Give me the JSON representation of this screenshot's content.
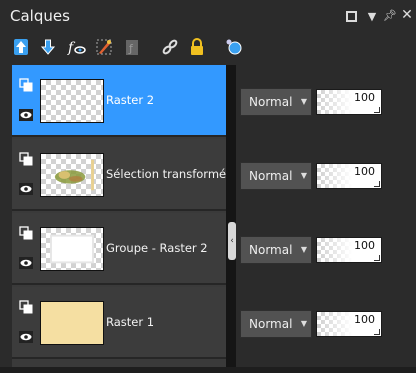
{
  "window": {
    "title": "Calques",
    "controls": [
      "restore-icon",
      "menu-arrow-icon",
      "pin-icon",
      "close-icon"
    ]
  },
  "toolbar": {
    "tools": [
      "new-raster-layer-icon",
      "new-vector-layer-icon",
      "effects-icon",
      "brush-icon",
      "mask-icon",
      "link-icon",
      "lock-icon",
      "layer-style-icon"
    ]
  },
  "layers": [
    {
      "name": "Raster 2",
      "blend": "Normal",
      "opacity": "100",
      "selected": true,
      "thumb": "transparent"
    },
    {
      "name": "Sélection transformée",
      "blend": "Normal",
      "opacity": "100",
      "selected": false,
      "thumb": "image"
    },
    {
      "name": "Groupe - Raster 2",
      "blend": "Normal",
      "opacity": "100",
      "selected": false,
      "thumb": "frame"
    },
    {
      "name": "Raster 1",
      "blend": "Normal",
      "opacity": "100",
      "selected": false,
      "thumb": "solid"
    }
  ],
  "colors": {
    "selection": "#3399ff",
    "panel_bg": "#2b2b2b",
    "raster1_fill": "#f5dfa2"
  }
}
